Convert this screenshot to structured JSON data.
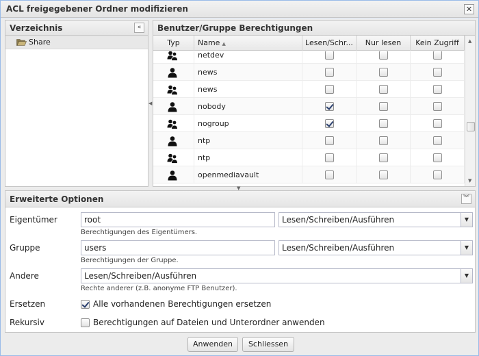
{
  "window": {
    "title": "ACL freigegebener Ordner modifizieren",
    "close_glyph": "✕"
  },
  "directory_panel": {
    "title": "Verzeichnis",
    "collapse_glyph": "«",
    "items": [
      {
        "label": "Share",
        "icon": "folder-open-icon"
      }
    ]
  },
  "permissions_panel": {
    "title": "Benutzer/Gruppe Berechtigungen",
    "columns": {
      "type": "Typ",
      "name": "Name",
      "read_write": "Lesen/Schr...",
      "read_only": "Nur lesen",
      "no_access": "Kein Zugriff"
    },
    "rows": [
      {
        "type": "group",
        "name": "netdev",
        "read_write": false,
        "read_only": false,
        "no_access": false
      },
      {
        "type": "user",
        "name": "news",
        "read_write": false,
        "read_only": false,
        "no_access": false
      },
      {
        "type": "group",
        "name": "news",
        "read_write": false,
        "read_only": false,
        "no_access": false
      },
      {
        "type": "user",
        "name": "nobody",
        "read_write": true,
        "read_only": false,
        "no_access": false
      },
      {
        "type": "group",
        "name": "nogroup",
        "read_write": true,
        "read_only": false,
        "no_access": false
      },
      {
        "type": "user",
        "name": "ntp",
        "read_write": false,
        "read_only": false,
        "no_access": false
      },
      {
        "type": "group",
        "name": "ntp",
        "read_write": false,
        "read_only": false,
        "no_access": false
      },
      {
        "type": "user",
        "name": "openmediavault",
        "read_write": false,
        "read_only": false,
        "no_access": false
      }
    ]
  },
  "advanced": {
    "title": "Erweiterte Optionen",
    "collapse_glyph": "︾",
    "owner": {
      "label": "Eigentümer",
      "value": "root",
      "permission": "Lesen/Schreiben/Ausführen",
      "hint": "Berechtigungen des Eigentümers."
    },
    "group": {
      "label": "Gruppe",
      "value": "users",
      "permission": "Lesen/Schreiben/Ausführen",
      "hint": "Berechtigungen der Gruppe."
    },
    "others": {
      "label": "Andere",
      "permission": "Lesen/Schreiben/Ausführen",
      "hint": "Rechte anderer (z.B. anonyme FTP Benutzer)."
    },
    "replace": {
      "label": "Ersetzen",
      "checked": true,
      "text": "Alle vorhandenen Berechtigungen ersetzen"
    },
    "recursive": {
      "label": "Rekursiv",
      "checked": false,
      "text": "Berechtigungen auf Dateien und Unterordner anwenden"
    }
  },
  "buttons": {
    "apply": "Anwenden",
    "close": "Schliessen"
  }
}
